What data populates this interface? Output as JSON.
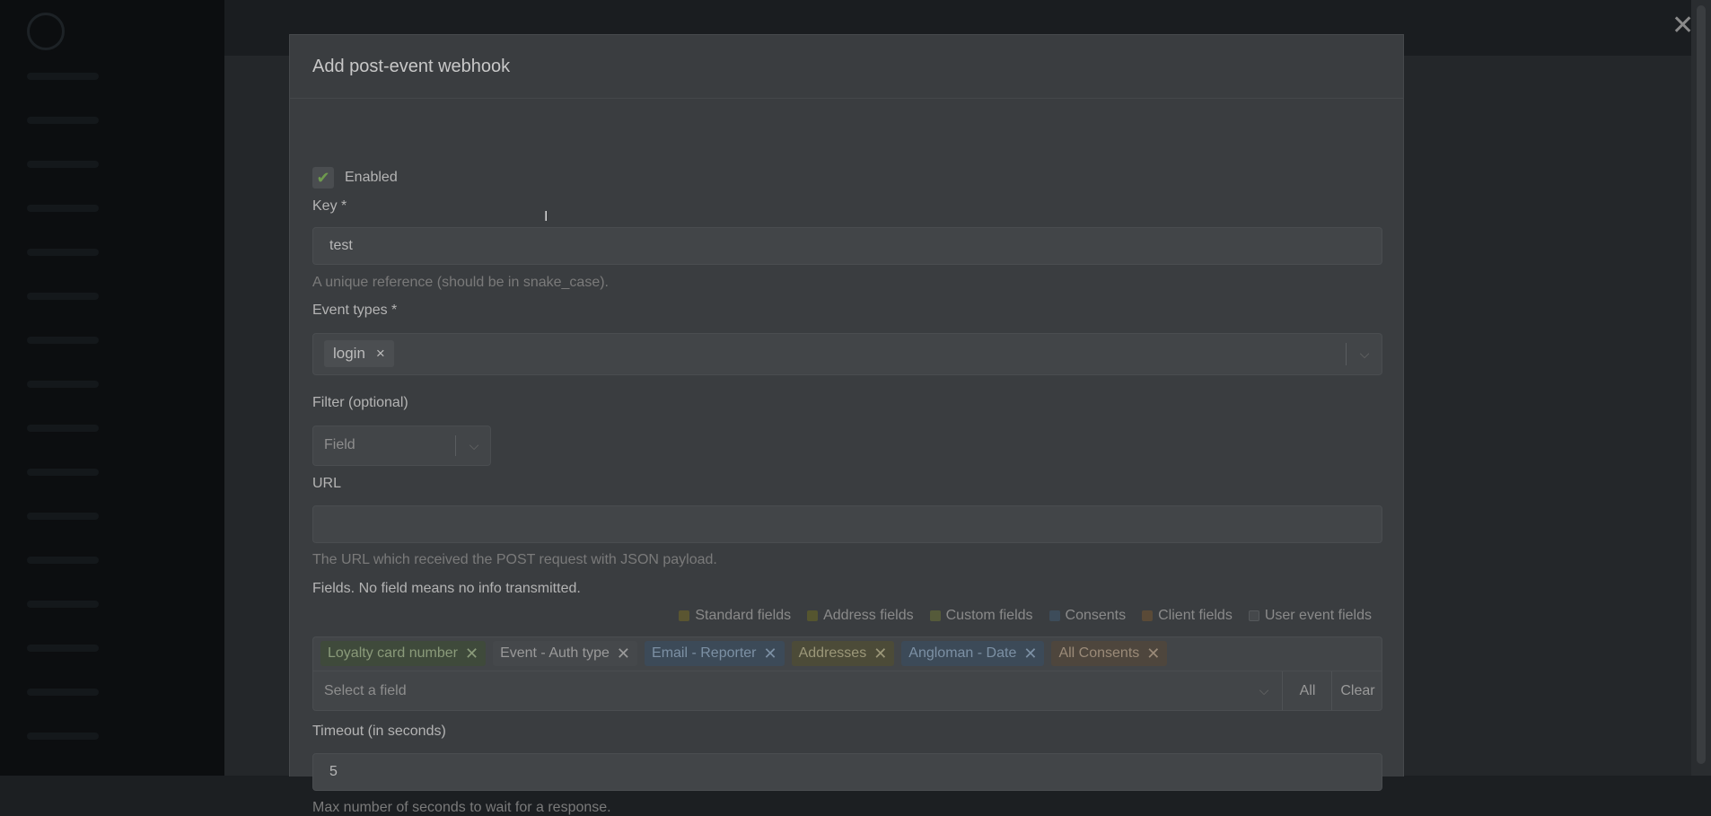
{
  "modal": {
    "title": "Add post-event webhook",
    "enabled_label": "Enabled",
    "key": {
      "label": "Key *",
      "value": "test",
      "help": "A unique reference (should be in snake_case)."
    },
    "event_types": {
      "label": "Event types *",
      "tags": [
        "login"
      ],
      "remove_glyph": "×"
    },
    "filter": {
      "label": "Filter (optional)",
      "placeholder": "Field"
    },
    "url": {
      "label": "URL",
      "value": "",
      "help": "The URL which received the POST request with JSON payload."
    },
    "fields": {
      "label": "Fields. No field means no info transmitted.",
      "legend": [
        {
          "label": "Standard fields",
          "color": "#5a5531"
        },
        {
          "label": "Address fields",
          "color": "#55552f"
        },
        {
          "label": "Custom fields",
          "color": "#555a3a"
        },
        {
          "label": "Consents",
          "color": "#3d4c5a"
        },
        {
          "label": "Client fields",
          "color": "#5a4a37"
        },
        {
          "label": "User event fields",
          "color": "#45484b"
        }
      ],
      "chips": [
        {
          "label": "Loyalty card number",
          "bg": "#3f4a3b",
          "fg": "#8a9a7a"
        },
        {
          "label": "Event - Auth type",
          "bg": "#45484b",
          "fg": "#9a9a9a"
        },
        {
          "label": "Email - Reporter",
          "bg": "#3c4a58",
          "fg": "#7c90a4"
        },
        {
          "label": "Addresses",
          "bg": "#4c4b38",
          "fg": "#9b9779"
        },
        {
          "label": "Angloman - Date",
          "bg": "#3c4a58",
          "fg": "#7c90a4"
        },
        {
          "label": "All Consents",
          "bg": "#4e463d",
          "fg": "#9a8a78"
        }
      ],
      "chip_remove_glyph": "✕",
      "select_placeholder": "Select a field",
      "all_label": "All",
      "clear_label": "Clear"
    },
    "timeout": {
      "label": "Timeout (in seconds)",
      "value": "5",
      "help": "Max number of seconds to wait for a response."
    }
  },
  "close_glyph": "✕",
  "chevron_glyph": "⌵",
  "check_glyph": "✔"
}
